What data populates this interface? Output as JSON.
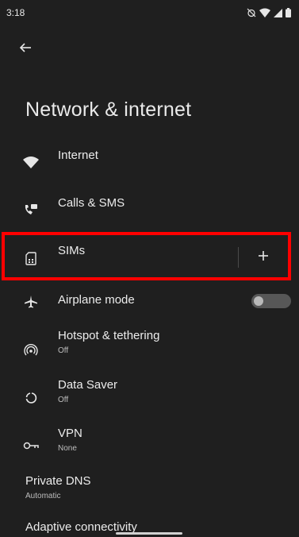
{
  "status_bar": {
    "time": "3:18",
    "icons": [
      "alarm-off-icon",
      "wifi-icon",
      "cell-signal-icon",
      "battery-icon"
    ]
  },
  "header": {
    "back_icon": "arrow-back-icon",
    "title": "Network & internet"
  },
  "items": [
    {
      "key": "internet",
      "icon": "wifi-icon",
      "label": "Internet",
      "sub": ""
    },
    {
      "key": "calls-sms",
      "icon": "calls-sms-icon",
      "label": "Calls & SMS",
      "sub": ""
    },
    {
      "key": "sims",
      "icon": "sim-card-icon",
      "label": "SIMs",
      "sub": "",
      "action_icon": "add-icon"
    },
    {
      "key": "airplane-mode",
      "icon": "airplane-icon",
      "label": "Airplane mode",
      "sub": "",
      "toggle": "off"
    },
    {
      "key": "hotspot",
      "icon": "hotspot-icon",
      "label": "Hotspot & tethering",
      "sub": "Off"
    },
    {
      "key": "data-saver",
      "icon": "data-saver-icon",
      "label": "Data Saver",
      "sub": "Off"
    },
    {
      "key": "vpn",
      "icon": "vpn-key-icon",
      "label": "VPN",
      "sub": "None"
    },
    {
      "key": "private-dns",
      "icon": "",
      "label": "Private DNS",
      "sub": "Automatic"
    },
    {
      "key": "adaptive-connectivity",
      "icon": "",
      "label": "Adaptive connectivity",
      "sub": ""
    }
  ],
  "colors": {
    "background": "#1f1f1f",
    "text": "#ececec",
    "subtext": "#bdbdbd",
    "highlight": "#ff0000",
    "toggle_off": "#575757"
  }
}
